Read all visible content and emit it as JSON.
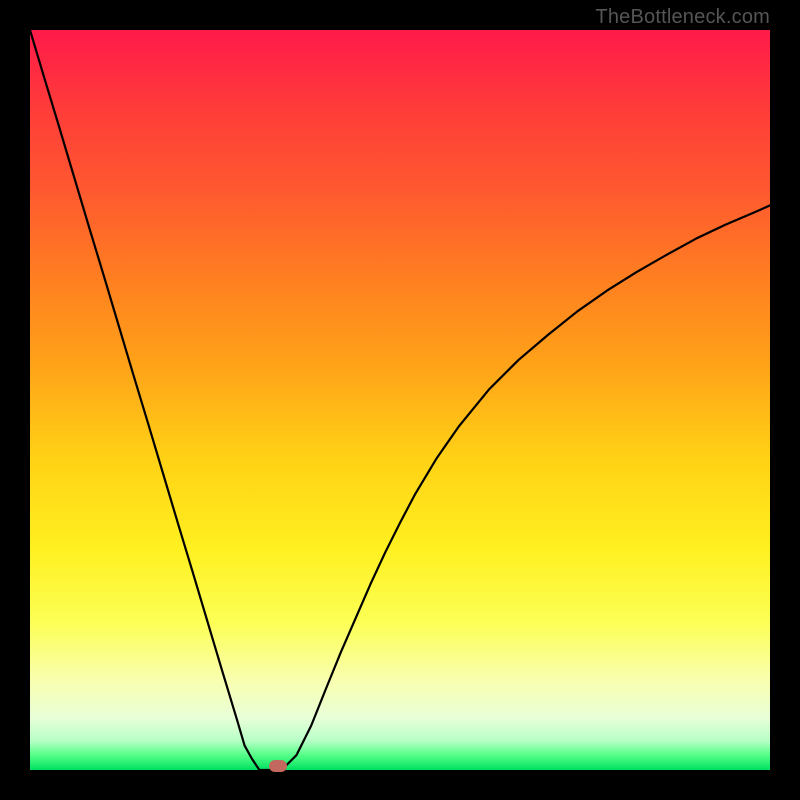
{
  "watermark": "TheBottleneck.com",
  "marker": {
    "cx_frac": 0.335,
    "cy_frac": 0.994
  },
  "colors": {
    "frame": "#000000",
    "curve": "#000000",
    "marker": "#c3685f"
  },
  "chart_data": {
    "type": "line",
    "title": "",
    "xlabel": "",
    "ylabel": "",
    "xlim": [
      0,
      100
    ],
    "ylim": [
      0,
      100
    ],
    "grid": false,
    "series": [
      {
        "name": "bottleneck-curve",
        "x": [
          0,
          2,
          4,
          6,
          8,
          10,
          12,
          14,
          16,
          18,
          20,
          22,
          24,
          26,
          28,
          29,
          30,
          31,
          32,
          33,
          34,
          35,
          36,
          38,
          40,
          42,
          44,
          46,
          48,
          50,
          52,
          55,
          58,
          62,
          66,
          70,
          74,
          78,
          82,
          86,
          90,
          94,
          98,
          100
        ],
        "y": [
          100,
          93.3,
          86.7,
          80.0,
          73.3,
          66.7,
          60.0,
          53.3,
          46.7,
          40.0,
          33.3,
          26.7,
          20.0,
          13.3,
          6.7,
          3.3,
          1.5,
          0.0,
          0.0,
          0.0,
          0.0,
          1.0,
          2.0,
          6.0,
          11.0,
          15.9,
          20.5,
          25.1,
          29.4,
          33.4,
          37.2,
          42.2,
          46.5,
          51.4,
          55.4,
          58.8,
          62.0,
          64.8,
          67.3,
          69.6,
          71.8,
          73.7,
          75.4,
          76.3
        ]
      }
    ],
    "annotations": [
      {
        "type": "marker",
        "x": 33.5,
        "y": 0.6,
        "label": "optimal-point"
      }
    ]
  }
}
